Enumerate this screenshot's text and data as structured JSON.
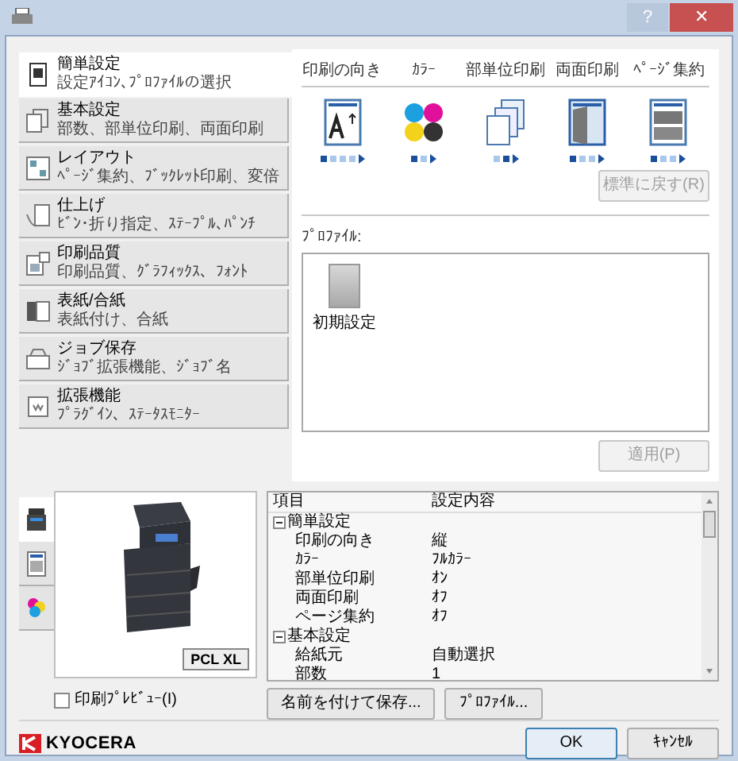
{
  "window": {
    "buttons": [
      {
        "kind": "help",
        "label": "?"
      },
      {
        "kind": "close",
        "label": "✕"
      }
    ]
  },
  "sidebar": {
    "items": [
      {
        "title": "簡単設定",
        "subtitle": "設定ｱｲｺﾝ､ﾌﾟﾛﾌｧｲﾙの選択",
        "selected": true
      },
      {
        "title": "基本設定",
        "subtitle": "部数、部単位印刷、両面印刷",
        "selected": false
      },
      {
        "title": "レイアウト",
        "subtitle": "ﾍﾟｰｼﾞ集約、ﾌﾞｯｸﾚｯﾄ印刷、変倍",
        "selected": false
      },
      {
        "title": "仕上げ",
        "subtitle": "ﾋﾞﾝ･折り指定、ｽﾃｰﾌﾟﾙ､ﾊﾟﾝﾁ",
        "selected": false
      },
      {
        "title": "印刷品質",
        "subtitle": "印刷品質、ｸﾞﾗﾌｨｯｸｽ、ﾌｫﾝﾄ",
        "selected": false
      },
      {
        "title": "表紙/合紙",
        "subtitle": "表紙付け、合紙",
        "selected": false
      },
      {
        "title": "ジョブ保存",
        "subtitle": "ｼﾞｮﾌﾞ拡張機能、ｼﾞｮﾌﾞ名",
        "selected": false
      },
      {
        "title": "拡張機能",
        "subtitle": "ﾌﾟﾗｸﾞｲﾝ、ｽﾃｰﾀｽﾓﾆﾀｰ",
        "selected": false
      }
    ]
  },
  "quick_settings": [
    {
      "label": "印刷の向き",
      "dots": [
        {
          "selected": true
        },
        {
          "selected": false
        },
        {
          "selected": false
        },
        {
          "selected": false
        }
      ]
    },
    {
      "label": "ｶﾗｰ",
      "dots": [
        {
          "selected": true
        },
        {
          "selected": false
        }
      ]
    },
    {
      "label": "部単位印刷",
      "dots": [
        {
          "selected": false
        },
        {
          "selected": true
        }
      ]
    },
    {
      "label": "両面印刷",
      "dots": [
        {
          "selected": true
        },
        {
          "selected": false
        },
        {
          "selected": false
        }
      ]
    },
    {
      "label": "ﾍﾟｰｼﾞ集約",
      "dots": [
        {
          "selected": true
        },
        {
          "selected": false
        },
        {
          "selected": false
        }
      ]
    }
  ],
  "reset_button": {
    "label": "標準に戻す(R)",
    "disabled": true
  },
  "profiles": {
    "label": "ﾌﾟﾛﾌｧｲﾙ:",
    "items": [
      {
        "label": "初期設定"
      }
    ]
  },
  "apply_button": {
    "label": "適用(P)",
    "disabled": true
  },
  "preview_tabs": [
    {
      "selected": true
    },
    {
      "selected": false
    },
    {
      "selected": false
    }
  ],
  "preview": {
    "badge": "PCL XL"
  },
  "print_preview": {
    "label": "印刷ﾌﾟﾚﾋﾞｭｰ(I)",
    "checked": false
  },
  "table": {
    "columns": [
      "項目",
      "設定内容"
    ],
    "groups": [
      {
        "label": "簡単設定",
        "expanded": true,
        "rows": [
          [
            "印刷の向き",
            "縦"
          ],
          [
            "ｶﾗｰ",
            "ﾌﾙｶﾗｰ"
          ],
          [
            "部単位印刷",
            "ｵﾝ"
          ],
          [
            "両面印刷",
            "ｵﾌ"
          ],
          [
            "ページ集約",
            "ｵﾌ"
          ]
        ]
      },
      {
        "label": "基本設定",
        "expanded": true,
        "rows": [
          [
            "給紙元",
            "自動選択"
          ],
          [
            "部数",
            "1"
          ]
        ]
      }
    ]
  },
  "table_buttons": [
    "名前を付けて保存...",
    "ﾌﾟﾛﾌｧｲﾙ..."
  ],
  "footer": {
    "logo": "KYOCERA",
    "buttons": [
      {
        "label": "OK",
        "primary": true
      },
      {
        "label": "ｷｬﾝｾﾙ",
        "primary": false
      }
    ]
  }
}
